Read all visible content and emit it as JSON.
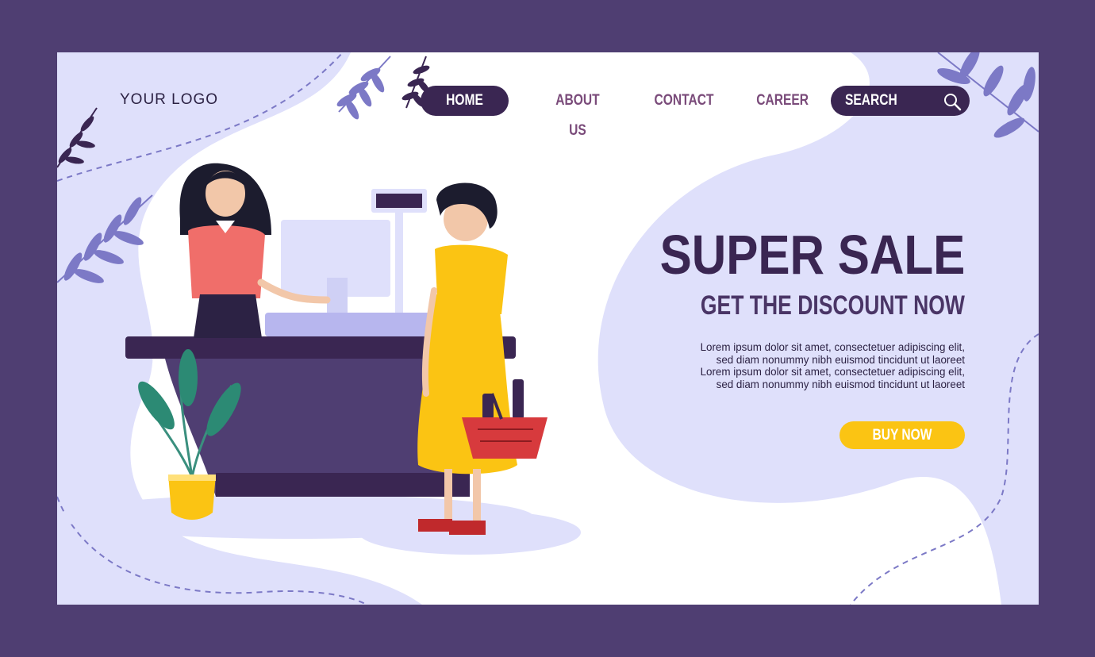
{
  "logo": {
    "text": "YOUR LOGO"
  },
  "nav": {
    "items": [
      {
        "label": "HOME",
        "active": true
      },
      {
        "label": "ABOUT US",
        "active": false
      },
      {
        "label": "CONTACT",
        "active": false
      },
      {
        "label": "CAREER",
        "active": false
      }
    ]
  },
  "search": {
    "label": "SEARCH",
    "icon": "search-icon"
  },
  "hero": {
    "headline": "SUPER SALE",
    "subheadline": "GET THE DISCOUNT NOW",
    "body_lines": [
      "Lorem ipsum dolor sit amet, consectetuer adipiscing elit,",
      "sed diam nonummy nibh euismod tincidunt ut laoreet",
      "Lorem ipsum dolor sit amet, consectetuer adipiscing elit,",
      "sed diam nonummy nibh euismod tincidunt ut laoreet"
    ],
    "cta_label": "BUY NOW"
  },
  "colors": {
    "outer_frame": "#4f3e72",
    "page_bg": "#dfe0fb",
    "dark_purple": "#3a2652",
    "nav_text": "#7a4b7a",
    "accent_yellow": "#fbc413"
  },
  "illustration": {
    "icons": [
      "cashier-icon",
      "customer-icon",
      "cash-register-icon",
      "shopping-basket-icon",
      "potted-plant-icon",
      "leaf-branch-icon"
    ]
  }
}
